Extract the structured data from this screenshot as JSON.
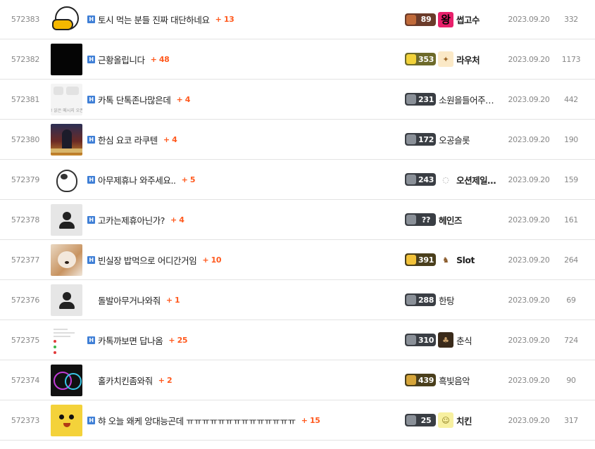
{
  "posts": [
    {
      "no": "572383",
      "thumb": "duck",
      "title": "토시 먹는 분들 진짜 대단하네요",
      "comments": "+ 13",
      "has_badge": true,
      "level": "89",
      "level_color": "#6b3b2a",
      "gem": "#c06a3a",
      "avatar": "왕",
      "avatar_bg": "#e8206b",
      "avatar_fg": "#000",
      "nickname": "썹고수",
      "bold": true,
      "date": "2023.09.20",
      "views": "332"
    },
    {
      "no": "572382",
      "thumb": "black",
      "title": "근황올립니다",
      "comments": "+ 48",
      "has_badge": true,
      "level": "353",
      "level_color": "#6d6a2a",
      "gem": "#f2d23a",
      "avatar": "✦",
      "avatar_bg": "#fbe9c7",
      "avatar_fg": "#a06a2a",
      "nickname": "라우처",
      "bold": true,
      "date": "2023.09.20",
      "views": "1173"
    },
    {
      "no": "572381",
      "thumb": "msg",
      "thumb_text": "! 읽은 메시지 오픈",
      "title": "카톡 단톡존나많은데",
      "comments": "+ 4",
      "has_badge": true,
      "level": "231",
      "level_color": "#3a3e44",
      "gem": "#8a9098",
      "avatar": "",
      "avatar_bg": "",
      "avatar_fg": "",
      "nickname": "소원을들어주…",
      "bold": false,
      "date": "2023.09.20",
      "views": "442"
    },
    {
      "no": "572380",
      "thumb": "nap",
      "title": "한심 요코 라쿠텐",
      "comments": "+ 4",
      "has_badge": true,
      "level": "172",
      "level_color": "#3a3e44",
      "gem": "#8a9098",
      "avatar": "",
      "avatar_bg": "",
      "avatar_fg": "",
      "nickname": "오공슬롯",
      "bold": false,
      "date": "2023.09.20",
      "views": "190"
    },
    {
      "no": "572379",
      "thumb": "cow",
      "title": "아무제휴나 와주세요..",
      "comments": "+ 5",
      "has_badge": true,
      "level": "243",
      "level_color": "#3a3e44",
      "gem": "#8a9098",
      "avatar": "◌",
      "avatar_bg": "#ffffff",
      "avatar_fg": "#999",
      "nickname": "오션제일…",
      "bold": true,
      "date": "2023.09.20",
      "views": "159"
    },
    {
      "no": "572378",
      "thumb": "default",
      "title": "고카는제휴아닌가?",
      "comments": "+ 4",
      "has_badge": true,
      "level": "??",
      "level_color": "#3a3e44",
      "gem": "#8a9098",
      "avatar": "",
      "avatar_bg": "",
      "avatar_fg": "",
      "nickname": "헤인즈",
      "bold": true,
      "date": "2023.09.20",
      "views": "161"
    },
    {
      "no": "572377",
      "thumb": "dog",
      "title": "빈실장 밥먹으로 어디간거임",
      "comments": "+ 10",
      "has_badge": true,
      "level": "391",
      "level_color": "#4a3f1c",
      "gem": "#f2c23a",
      "avatar": "♞",
      "avatar_bg": "#ffffff",
      "avatar_fg": "#8a5a2a",
      "nickname": "Slot",
      "bold": true,
      "date": "2023.09.20",
      "views": "264"
    },
    {
      "no": "572376",
      "thumb": "default",
      "title": "돌발아무거나와줘",
      "comments": "+ 1",
      "has_badge": false,
      "level": "288",
      "level_color": "#3a3e44",
      "gem": "#8a9098",
      "avatar": "",
      "avatar_bg": "",
      "avatar_fg": "",
      "nickname": "한탕",
      "bold": false,
      "date": "2023.09.20",
      "views": "69"
    },
    {
      "no": "572375",
      "thumb": "chat",
      "title": "카톡까보면 답나옴",
      "comments": "+ 25",
      "has_badge": true,
      "level": "310",
      "level_color": "#3a3e44",
      "gem": "#8a9098",
      "avatar": "♣",
      "avatar_bg": "#3a2a1a",
      "avatar_fg": "#c9a06a",
      "nickname": "춘식",
      "bold": false,
      "date": "2023.09.20",
      "views": "724"
    },
    {
      "no": "572374",
      "thumb": "neon",
      "title": "홀카치킨좀와줘",
      "comments": "+ 2",
      "has_badge": false,
      "level": "439",
      "level_color": "#4a3f1c",
      "gem": "#d6a53a",
      "avatar": "",
      "avatar_bg": "",
      "avatar_fg": "",
      "nickname": "흑빛음악",
      "bold": false,
      "date": "2023.09.20",
      "views": "90"
    },
    {
      "no": "572373",
      "thumb": "yellow",
      "title": "햐 오늘 왜케 앙대능곤데 ㅠㅠㅠㅠㅠㅠㅠㅠㅠㅠㅠㅠㅠㅠ",
      "comments": "+ 15",
      "has_badge": true,
      "level": "25",
      "level_color": "#3a3e44",
      "gem": "#8a9098",
      "avatar": "☺",
      "avatar_bg": "#f7f0a0",
      "avatar_fg": "#8a7a1a",
      "nickname": "치킨",
      "bold": true,
      "date": "2023.09.20",
      "views": "317"
    }
  ],
  "ui": {
    "badge_letter": "H",
    "accent_comment": "#ff5a1f",
    "accent_badge": "#3f7fd6"
  }
}
